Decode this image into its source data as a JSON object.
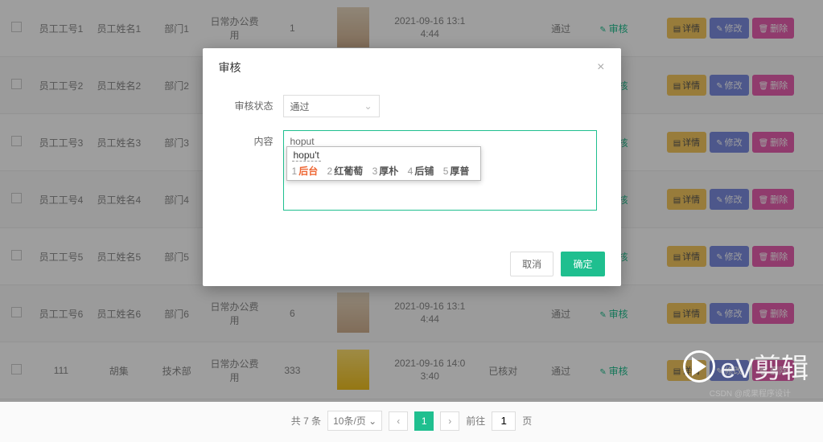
{
  "modal": {
    "title": "审核",
    "status_label": "审核状态",
    "status_value": "通过",
    "content_label": "内容",
    "content_value": "hoput",
    "cancel": "取消",
    "ok": "确定"
  },
  "ime": {
    "composition": "hopu't",
    "candidates": [
      {
        "n": "1",
        "t": "后台"
      },
      {
        "n": "2",
        "t": "红葡萄"
      },
      {
        "n": "3",
        "t": "厚朴"
      },
      {
        "n": "4",
        "t": "后铺"
      },
      {
        "n": "5",
        "t": "厚普"
      }
    ]
  },
  "buttons": {
    "detail": "详情",
    "edit": "修改",
    "del": "删除",
    "audit": "审核"
  },
  "rows": [
    {
      "id": "员工工号1",
      "name": "员工姓名1",
      "dept": "部门1",
      "type": "日常办公费用",
      "qty": "1",
      "time1": "2021-09-16 13:1",
      "time2": "4:44",
      "s1": "",
      "s2": "通过"
    },
    {
      "id": "员工工号2",
      "name": "员工姓名2",
      "dept": "部门2",
      "type": "",
      "qty": "",
      "time1": "",
      "time2": "",
      "s1": "",
      "s2": ""
    },
    {
      "id": "员工工号3",
      "name": "员工姓名3",
      "dept": "部门3",
      "type": "",
      "qty": "",
      "time1": "",
      "time2": "",
      "s1": "",
      "s2": ""
    },
    {
      "id": "员工工号4",
      "name": "员工姓名4",
      "dept": "部门4",
      "type": "",
      "qty": "",
      "time1": "",
      "time2": "",
      "s1": "",
      "s2": ""
    },
    {
      "id": "员工工号5",
      "name": "员工姓名5",
      "dept": "部门5",
      "type": "",
      "qty": "",
      "time1": "",
      "time2": "",
      "s1": "",
      "s2": ""
    },
    {
      "id": "员工工号6",
      "name": "员工姓名6",
      "dept": "部门6",
      "type": "日常办公费用",
      "qty": "6",
      "time1": "2021-09-16 13:1",
      "time2": "4:44",
      "s1": "",
      "s2": "通过"
    },
    {
      "id": "111",
      "name": "胡集",
      "dept": "技术部",
      "type": "日常办公费用",
      "qty": "333",
      "time1": "2021-09-16 14:0",
      "time2": "3:40",
      "s1": "已核对",
      "s2": "通过"
    }
  ],
  "pager": {
    "total": "共 7 条",
    "size": "10条/页",
    "page": "1",
    "goto_label": "前往",
    "goto_val": "1",
    "goto_suffix": "页"
  },
  "watermark": "eV剪辑",
  "csdn": "CSDN @成果程序设计"
}
